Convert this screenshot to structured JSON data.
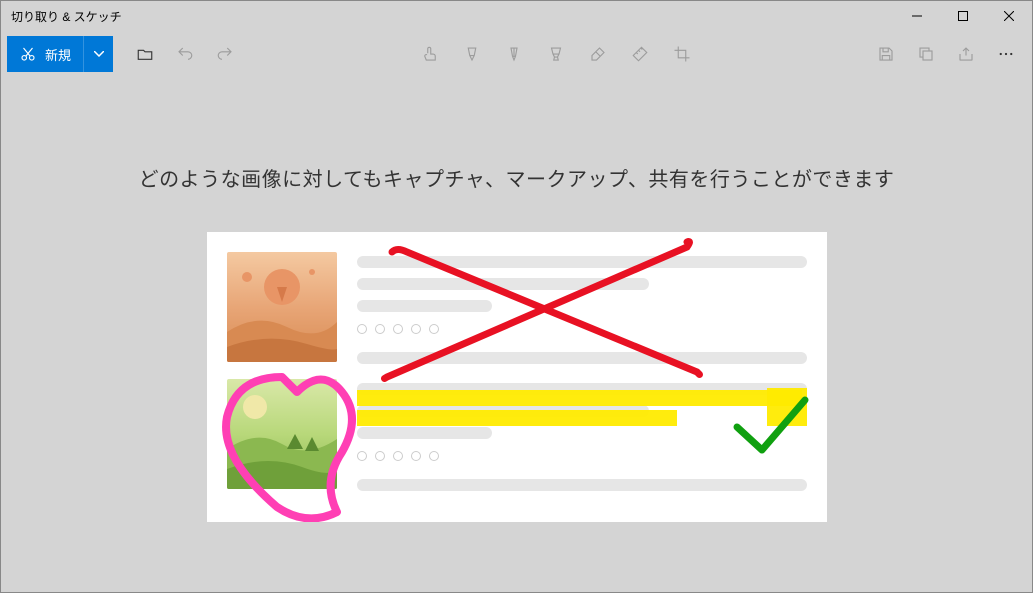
{
  "window": {
    "title": "切り取り & スケッチ"
  },
  "toolbar": {
    "new_label": "新規"
  },
  "content": {
    "intro_text": "どのような画像に対してもキャプチャ、マークアップ、共有を行うことができます"
  },
  "icons": {
    "new": "snip-icon",
    "open": "folder-open-icon",
    "undo": "undo-icon",
    "redo": "redo-icon",
    "touch": "touch-write-icon",
    "ballpoint": "ballpoint-pen-icon",
    "pencil": "pencil-icon",
    "highlighter": "highlighter-icon",
    "eraser": "eraser-icon",
    "ruler": "ruler-icon",
    "crop": "crop-icon",
    "save": "save-icon",
    "copy": "copy-icon",
    "share": "share-icon",
    "more": "more-icon"
  }
}
